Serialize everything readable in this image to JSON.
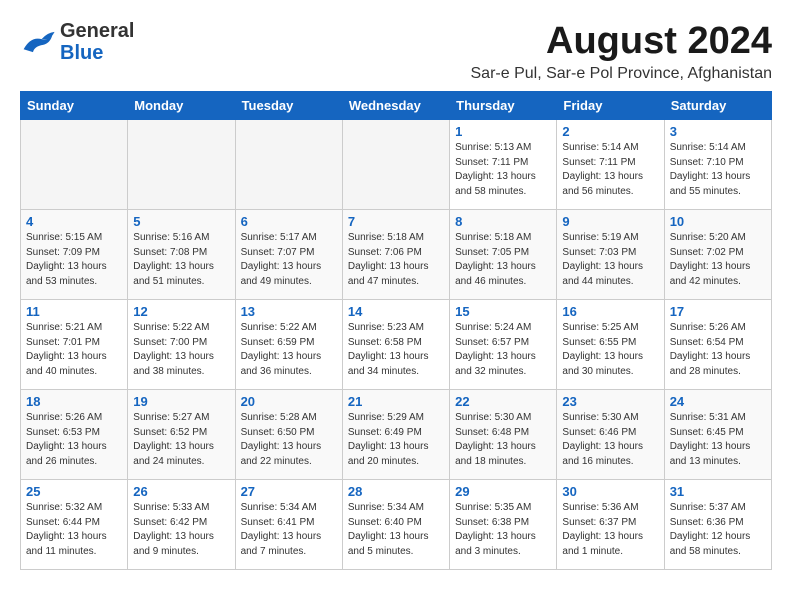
{
  "header": {
    "logo_general": "General",
    "logo_blue": "Blue",
    "month_year": "August 2024",
    "location": "Sar-e Pul, Sar-e Pol Province, Afghanistan"
  },
  "days_of_week": [
    "Sunday",
    "Monday",
    "Tuesday",
    "Wednesday",
    "Thursday",
    "Friday",
    "Saturday"
  ],
  "weeks": [
    [
      {
        "day": "",
        "info": ""
      },
      {
        "day": "",
        "info": ""
      },
      {
        "day": "",
        "info": ""
      },
      {
        "day": "",
        "info": ""
      },
      {
        "day": "1",
        "info": "Sunrise: 5:13 AM\nSunset: 7:11 PM\nDaylight: 13 hours\nand 58 minutes."
      },
      {
        "day": "2",
        "info": "Sunrise: 5:14 AM\nSunset: 7:11 PM\nDaylight: 13 hours\nand 56 minutes."
      },
      {
        "day": "3",
        "info": "Sunrise: 5:14 AM\nSunset: 7:10 PM\nDaylight: 13 hours\nand 55 minutes."
      }
    ],
    [
      {
        "day": "4",
        "info": "Sunrise: 5:15 AM\nSunset: 7:09 PM\nDaylight: 13 hours\nand 53 minutes."
      },
      {
        "day": "5",
        "info": "Sunrise: 5:16 AM\nSunset: 7:08 PM\nDaylight: 13 hours\nand 51 minutes."
      },
      {
        "day": "6",
        "info": "Sunrise: 5:17 AM\nSunset: 7:07 PM\nDaylight: 13 hours\nand 49 minutes."
      },
      {
        "day": "7",
        "info": "Sunrise: 5:18 AM\nSunset: 7:06 PM\nDaylight: 13 hours\nand 47 minutes."
      },
      {
        "day": "8",
        "info": "Sunrise: 5:18 AM\nSunset: 7:05 PM\nDaylight: 13 hours\nand 46 minutes."
      },
      {
        "day": "9",
        "info": "Sunrise: 5:19 AM\nSunset: 7:03 PM\nDaylight: 13 hours\nand 44 minutes."
      },
      {
        "day": "10",
        "info": "Sunrise: 5:20 AM\nSunset: 7:02 PM\nDaylight: 13 hours\nand 42 minutes."
      }
    ],
    [
      {
        "day": "11",
        "info": "Sunrise: 5:21 AM\nSunset: 7:01 PM\nDaylight: 13 hours\nand 40 minutes."
      },
      {
        "day": "12",
        "info": "Sunrise: 5:22 AM\nSunset: 7:00 PM\nDaylight: 13 hours\nand 38 minutes."
      },
      {
        "day": "13",
        "info": "Sunrise: 5:22 AM\nSunset: 6:59 PM\nDaylight: 13 hours\nand 36 minutes."
      },
      {
        "day": "14",
        "info": "Sunrise: 5:23 AM\nSunset: 6:58 PM\nDaylight: 13 hours\nand 34 minutes."
      },
      {
        "day": "15",
        "info": "Sunrise: 5:24 AM\nSunset: 6:57 PM\nDaylight: 13 hours\nand 32 minutes."
      },
      {
        "day": "16",
        "info": "Sunrise: 5:25 AM\nSunset: 6:55 PM\nDaylight: 13 hours\nand 30 minutes."
      },
      {
        "day": "17",
        "info": "Sunrise: 5:26 AM\nSunset: 6:54 PM\nDaylight: 13 hours\nand 28 minutes."
      }
    ],
    [
      {
        "day": "18",
        "info": "Sunrise: 5:26 AM\nSunset: 6:53 PM\nDaylight: 13 hours\nand 26 minutes."
      },
      {
        "day": "19",
        "info": "Sunrise: 5:27 AM\nSunset: 6:52 PM\nDaylight: 13 hours\nand 24 minutes."
      },
      {
        "day": "20",
        "info": "Sunrise: 5:28 AM\nSunset: 6:50 PM\nDaylight: 13 hours\nand 22 minutes."
      },
      {
        "day": "21",
        "info": "Sunrise: 5:29 AM\nSunset: 6:49 PM\nDaylight: 13 hours\nand 20 minutes."
      },
      {
        "day": "22",
        "info": "Sunrise: 5:30 AM\nSunset: 6:48 PM\nDaylight: 13 hours\nand 18 minutes."
      },
      {
        "day": "23",
        "info": "Sunrise: 5:30 AM\nSunset: 6:46 PM\nDaylight: 13 hours\nand 16 minutes."
      },
      {
        "day": "24",
        "info": "Sunrise: 5:31 AM\nSunset: 6:45 PM\nDaylight: 13 hours\nand 13 minutes."
      }
    ],
    [
      {
        "day": "25",
        "info": "Sunrise: 5:32 AM\nSunset: 6:44 PM\nDaylight: 13 hours\nand 11 minutes."
      },
      {
        "day": "26",
        "info": "Sunrise: 5:33 AM\nSunset: 6:42 PM\nDaylight: 13 hours\nand 9 minutes."
      },
      {
        "day": "27",
        "info": "Sunrise: 5:34 AM\nSunset: 6:41 PM\nDaylight: 13 hours\nand 7 minutes."
      },
      {
        "day": "28",
        "info": "Sunrise: 5:34 AM\nSunset: 6:40 PM\nDaylight: 13 hours\nand 5 minutes."
      },
      {
        "day": "29",
        "info": "Sunrise: 5:35 AM\nSunset: 6:38 PM\nDaylight: 13 hours\nand 3 minutes."
      },
      {
        "day": "30",
        "info": "Sunrise: 5:36 AM\nSunset: 6:37 PM\nDaylight: 13 hours\nand 1 minute."
      },
      {
        "day": "31",
        "info": "Sunrise: 5:37 AM\nSunset: 6:36 PM\nDaylight: 12 hours\nand 58 minutes."
      }
    ]
  ]
}
